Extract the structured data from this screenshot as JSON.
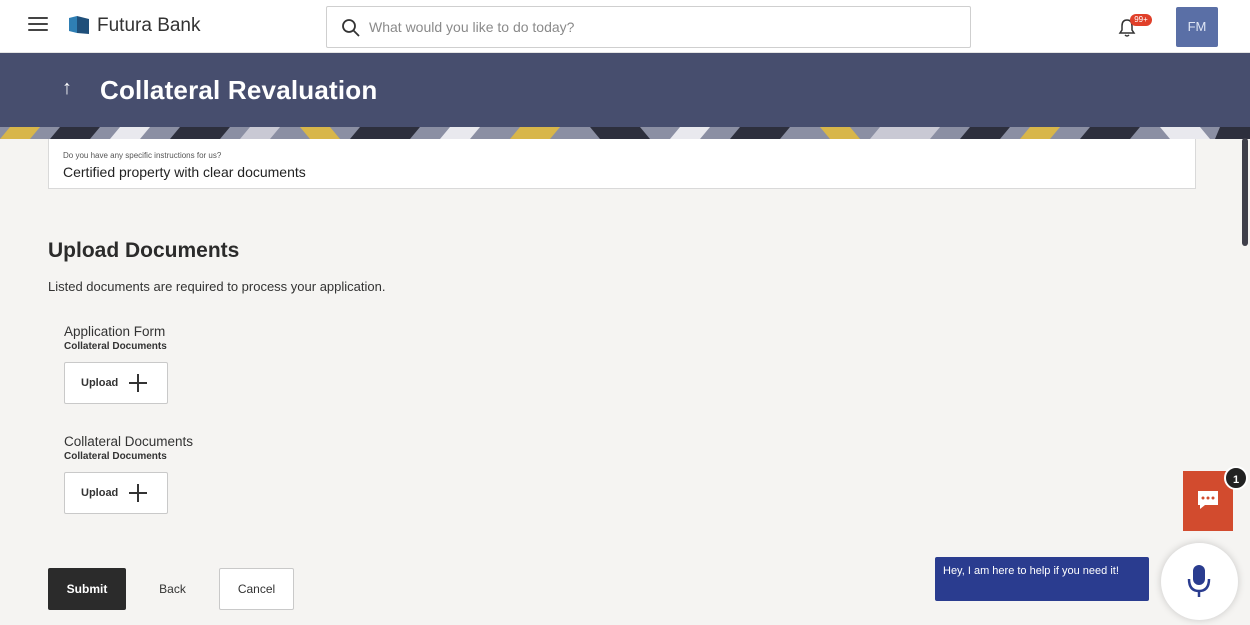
{
  "header": {
    "brand": "Futura Bank",
    "search_placeholder": "What would you like to do today?",
    "notification_badge": "99+",
    "user_initials": "FM"
  },
  "page": {
    "title": "Collateral Revaluation",
    "back_arrow": "↑"
  },
  "instructions": {
    "label": "Do you have any specific instructions for us?",
    "value": "Certified property with clear documents"
  },
  "upload_section": {
    "title": "Upload Documents",
    "description": "Listed documents are required to process your application.",
    "documents": [
      {
        "name": "Application Form",
        "category": "Collateral Documents",
        "button_label": "Upload"
      },
      {
        "name": "Collateral Documents",
        "category": "Collateral Documents",
        "button_label": "Upload"
      }
    ]
  },
  "actions": {
    "submit": "Submit",
    "back": "Back",
    "cancel": "Cancel"
  },
  "chat": {
    "unread_count": "1",
    "bot_message": "Hey, I am here to help if you need it!"
  },
  "colors": {
    "header_bg": "#474e6e",
    "accent_red": "#d24b2e",
    "bot_blue": "#2a3c8f",
    "avatar_bg": "#5a6fa6"
  },
  "icons": [
    "menu-icon",
    "bank-logo-icon",
    "search-icon",
    "bell-icon",
    "back-arrow-icon",
    "plus-icon",
    "chat-icon",
    "mic-icon"
  ]
}
